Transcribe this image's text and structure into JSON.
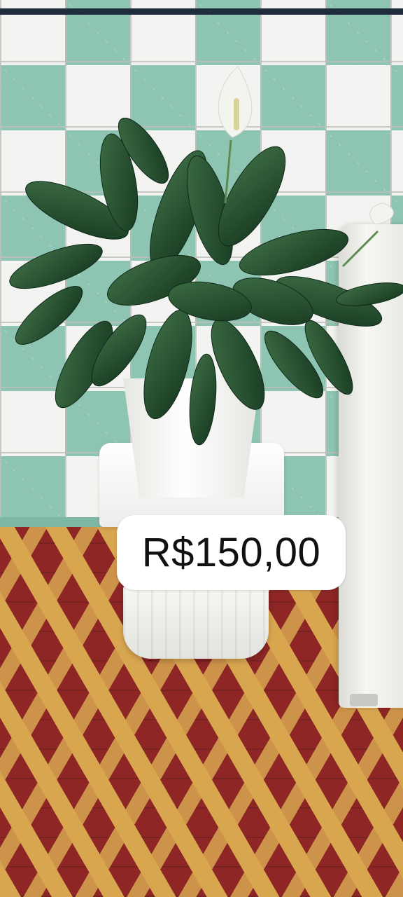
{
  "photo": {
    "subject": "peace-lily-plant",
    "pot_icon": "white-flower-pot-icon",
    "pedestal_icon": "white-column-pedestal-icon"
  },
  "price_tag": {
    "text": "R$150,00"
  },
  "colors": {
    "wall_tile": "#8ec5b2",
    "floor_red": "#8e2626",
    "floor_yellow": "#d9a650",
    "leaf": "#1f4a2a"
  }
}
